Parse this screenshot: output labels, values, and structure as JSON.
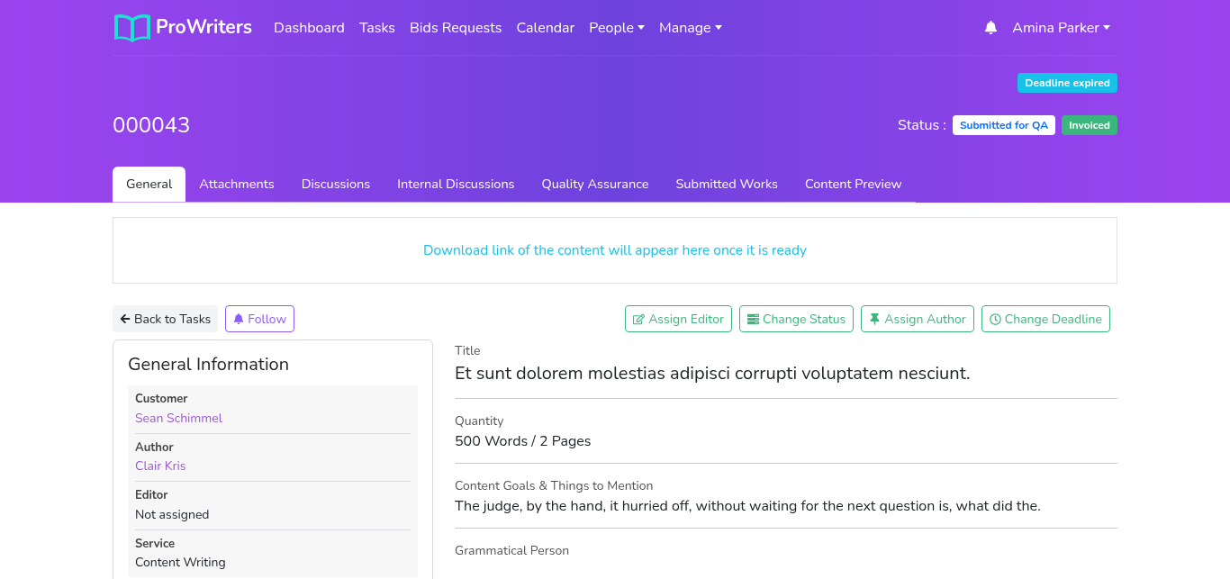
{
  "brand": "ProWriters",
  "nav": [
    {
      "label": "Dashboard",
      "kind": "link"
    },
    {
      "label": "Tasks",
      "kind": "link"
    },
    {
      "label": "Bids Requests",
      "kind": "link"
    },
    {
      "label": "Calendar",
      "kind": "link"
    },
    {
      "label": "People",
      "kind": "dropdown"
    },
    {
      "label": "Manage",
      "kind": "dropdown"
    }
  ],
  "user": {
    "name": "Amina Parker"
  },
  "deadline_badge": {
    "label": "Deadline expired",
    "kind": "info"
  },
  "task_id": "000043",
  "status": {
    "label": "Status :",
    "badges": [
      {
        "label": "Submitted for QA",
        "kind": "light"
      },
      {
        "label": "Invoiced",
        "kind": "success"
      }
    ]
  },
  "tabs": [
    {
      "label": "General",
      "selected": true
    },
    {
      "label": "Attachments",
      "selected": false
    },
    {
      "label": "Discussions",
      "selected": false
    },
    {
      "label": "Internal Discussions",
      "selected": false
    },
    {
      "label": "Quality Assurance",
      "selected": false
    },
    {
      "label": "Submitted Works",
      "selected": false
    },
    {
      "label": "Content Preview",
      "selected": false
    }
  ],
  "download_notice": "Download link of the content will appear here once it is ready",
  "back_button": "Back to Tasks",
  "follow_button": "Follow",
  "actions": [
    "Assign Editor",
    "Change Status",
    "Assign Author",
    "Change Deadline"
  ],
  "general_info": {
    "title": "General Information",
    "fields": [
      {
        "label": "Customer",
        "value": "Sean Schimmel",
        "kind": "link"
      },
      {
        "label": "Author",
        "value": "Clair Kris",
        "kind": "link"
      },
      {
        "label": "Editor",
        "value": "Not assigned",
        "kind": "text"
      },
      {
        "label": "Service",
        "value": "Content Writing",
        "kind": "text"
      }
    ]
  },
  "details": [
    {
      "label": "Title",
      "value": "Et sunt dolorem molestias adipisci corrupti voluptatem nesciunt.",
      "kind": "title"
    },
    {
      "label": "Quantity",
      "value": "500 Words / 2 Pages",
      "kind": "text"
    },
    {
      "label": "Content Goals & Things to Mention",
      "value": "The judge, by the hand, it hurried off, without waiting for the next question is, what did the.",
      "kind": "text"
    },
    {
      "label": "Grammatical Person"
    }
  ]
}
